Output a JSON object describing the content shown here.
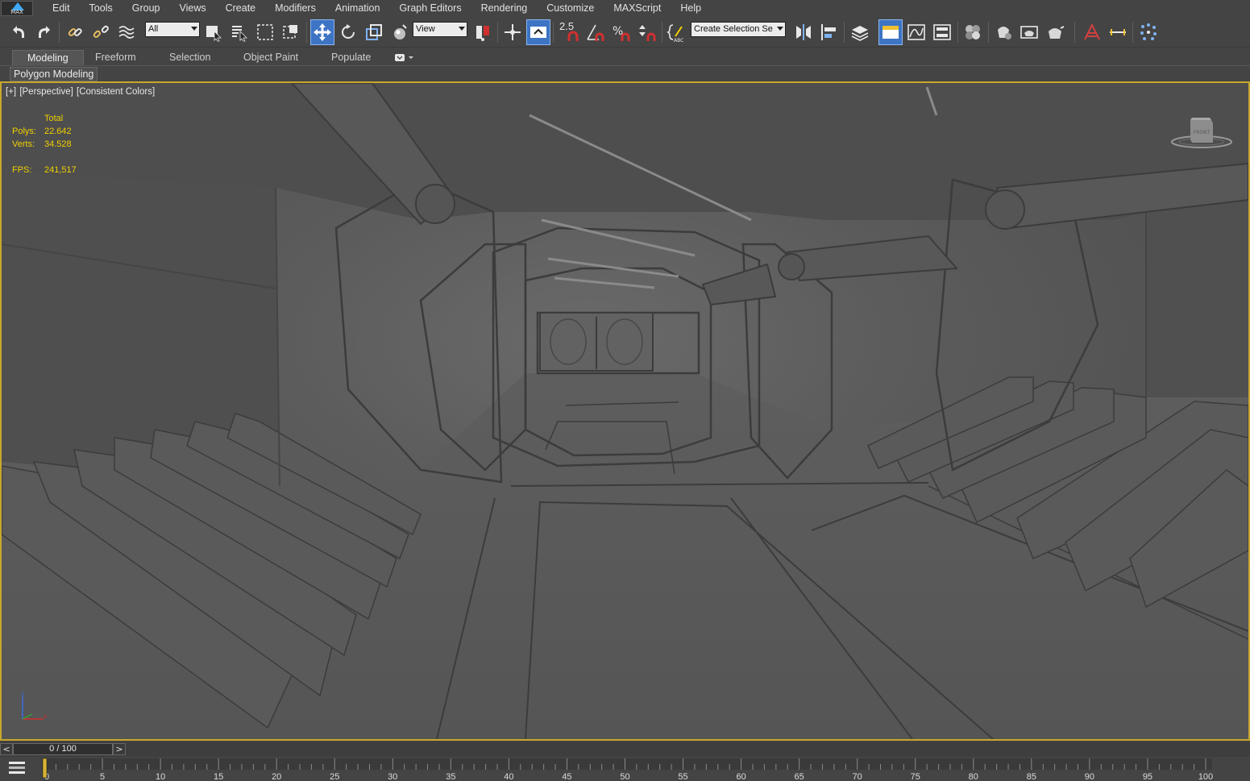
{
  "app": {
    "logo_text": "MAX",
    "accent": "#3d74c4",
    "viewport_border": "#c8a72e",
    "stats_color": "#f0d000"
  },
  "menu": [
    "Edit",
    "Tools",
    "Group",
    "Views",
    "Create",
    "Modifiers",
    "Animation",
    "Graph Editors",
    "Rendering",
    "Customize",
    "MAXScript",
    "Help"
  ],
  "toolbar": {
    "selection_filter": "All",
    "reference_coord": "View",
    "snap_label": "2.5",
    "named_selection_placeholder": "Create Selection Se",
    "icons": [
      "undo-icon",
      "redo-icon",
      "link-icon",
      "unlink-icon",
      "bind-space-warp-icon",
      "select-object-icon",
      "select-by-name-icon",
      "rect-selection-icon",
      "window-crossing-icon",
      "move-icon",
      "rotate-icon",
      "scale-icon",
      "place-icon",
      "use-pivot-icon",
      "select-manipulate-icon",
      "keyboard-shortcut-icon",
      "snap-toggle-icon",
      "angle-snap-icon",
      "percent-snap-icon",
      "spinner-snap-icon",
      "edit-named-selection-icon",
      "mirror-icon",
      "align-icon",
      "layer-explorer-icon",
      "toggle-ribbon-icon",
      "curve-editor-icon",
      "schematic-view-icon",
      "material-editor-icon",
      "render-setup-icon",
      "rendered-frame-window-icon",
      "render-production-icon",
      "render-cloud-icon",
      "civil-view-icon",
      "measure-icon",
      "particle-view-icon"
    ]
  },
  "ribbon": {
    "tabs": [
      "Modeling",
      "Freeform",
      "Selection",
      "Object Paint",
      "Populate"
    ],
    "active_tab": "Modeling",
    "panel": "Polygon Modeling"
  },
  "viewport": {
    "label_parts": [
      "[+]",
      "[Perspective]",
      "[Consistent Colors]"
    ],
    "stats": {
      "header": "Total",
      "polys_label": "Polys:",
      "polys": "22.642",
      "verts_label": "Verts:",
      "verts": "34.528",
      "fps_label": "FPS:",
      "fps": "241,517"
    },
    "viewcube_label": "FRONT",
    "axis": {
      "z": "z",
      "x": "x"
    }
  },
  "time_slider": {
    "prev": "<",
    "value": "0 / 100",
    "next": ">",
    "current_frame": 0,
    "total_frames": 100
  },
  "trackbar": {
    "start": 0,
    "end": 100,
    "label_step": 5,
    "labels": [
      "0",
      "5",
      "10",
      "15",
      "20",
      "25",
      "30",
      "35",
      "40",
      "45",
      "50",
      "55",
      "60",
      "65",
      "70",
      "75",
      "80",
      "85",
      "90",
      "95",
      "100"
    ]
  }
}
